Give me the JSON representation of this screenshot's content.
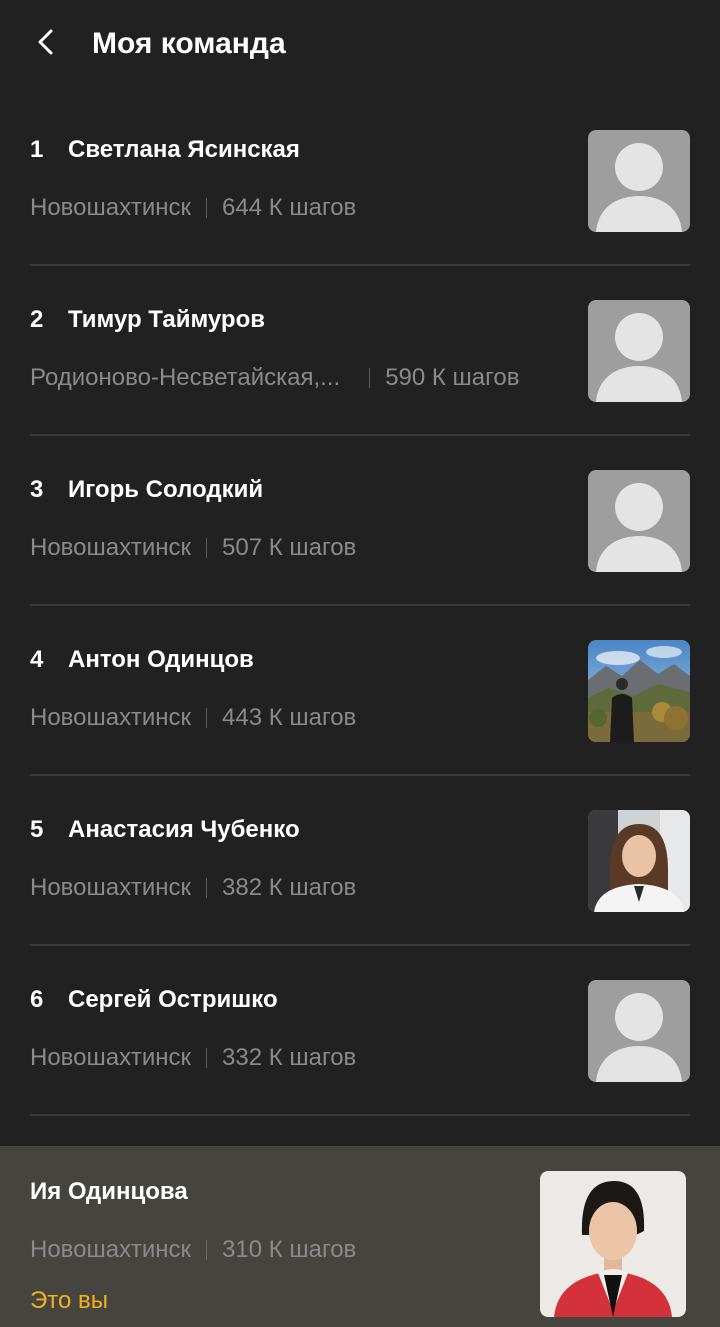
{
  "header": {
    "title": "Моя команда",
    "back_icon": "chevron-left-icon"
  },
  "team": [
    {
      "rank": "1",
      "name": "Светлана Ясинская",
      "city": "Новошахтинск",
      "steps": "644 К шагов",
      "avatar": "placeholder"
    },
    {
      "rank": "2",
      "name": "Тимур Таймуров",
      "city": "Родионово-Несветайская,...",
      "steps": "590 К шагов",
      "avatar": "placeholder"
    },
    {
      "rank": "3",
      "name": "Игорь Солодкий",
      "city": "Новошахтинск",
      "steps": "507 К шагов",
      "avatar": "placeholder"
    },
    {
      "rank": "4",
      "name": "Антон Одинцов",
      "city": "Новошахтинск",
      "steps": "443 К шагов",
      "avatar": "photo"
    },
    {
      "rank": "5",
      "name": "Анастасия Чубенко",
      "city": "Новошахтинск",
      "steps": "382 К шагов",
      "avatar": "photo"
    },
    {
      "rank": "6",
      "name": "Сергей Остришко",
      "city": "Новошахтинск",
      "steps": "332 К шагов",
      "avatar": "placeholder"
    }
  ],
  "current_user": {
    "name": "Ия Одинцова",
    "city": "Новошахтинск",
    "steps": "310 К шагов",
    "you_label": "Это вы"
  },
  "colors": {
    "background": "#212121",
    "footer_background": "#46443f",
    "accent": "#f2b01e",
    "secondary_text": "#8a8a8a",
    "placeholder": "#9e9e9e"
  }
}
